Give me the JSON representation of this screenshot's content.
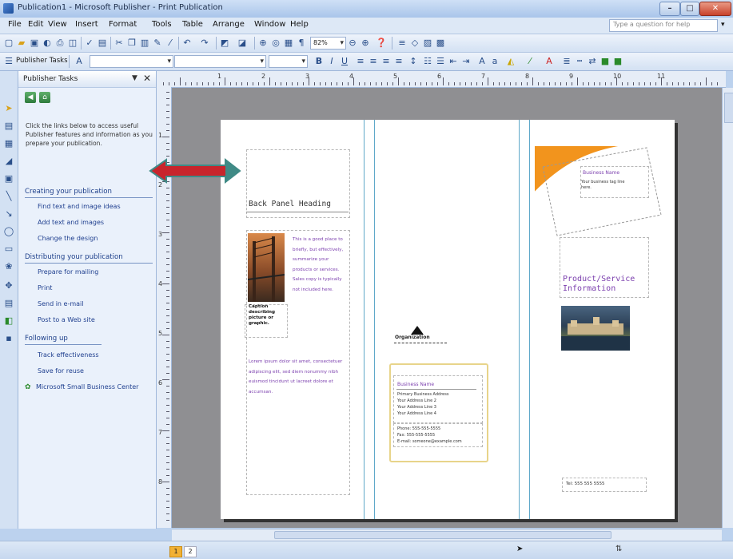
{
  "window": {
    "title": "Publication1 - Microsoft Publisher - Print Publication"
  },
  "menu": {
    "items": [
      "File",
      "Edit",
      "View",
      "Insert",
      "Format",
      "Tools",
      "Table",
      "Arrange",
      "Window",
      "Help"
    ],
    "help_placeholder": "Type a question for help"
  },
  "toolbar": {
    "zoom": "82%",
    "tasks_button": "Publisher Tasks"
  },
  "task_pane": {
    "title": "Publisher Tasks",
    "intro": "Click the links below to access useful Publisher features and information as you prepare your publication.",
    "sections": [
      {
        "title": "Creating your publication",
        "links": [
          "Find text and image ideas",
          "Add text and images",
          "Change the design"
        ]
      },
      {
        "title": "Distributing your publication",
        "links": [
          "Prepare for mailing",
          "Print",
          "Send in e-mail",
          "Post to a Web site"
        ]
      },
      {
        "title": "Following up",
        "links": [
          "Track effectiveness",
          "Save for reuse",
          "Microsoft Small Business Center"
        ]
      }
    ]
  },
  "ruler": {
    "h_labels": [
      "1",
      "2",
      "3",
      "4",
      "5",
      "6",
      "7",
      "8",
      "9",
      "10",
      "11"
    ],
    "v_labels": [
      "1",
      "2",
      "3",
      "4",
      "5",
      "6",
      "7",
      "8"
    ]
  },
  "document": {
    "back_panel_heading": "Back Panel Heading",
    "panel_text": "This is a good place to briefly, but effectively, summarize your products or services. Sales copy is typically not included here.",
    "panel_text_more": "Lorem ipsum dolor sit amet, consectetuer adipiscing elit, sed diem nonummy nibh euismod tincidunt ut lacreet dolore et accumsan.",
    "caption": "Caption describing picture or graphic.",
    "organization": "Organization",
    "business_name": "Business Name",
    "biz_lines": [
      "Primary Business Address",
      "Your Address Line 2",
      "Your Address Line 3",
      "Your Address Line 4"
    ],
    "biz_lines_2": [
      "Phone: 555-555-5555",
      "Fax: 555-555-5555",
      "E-mail: someone@example.com"
    ],
    "card_name": "Business Name",
    "card_tagline": "Your business tag line here.",
    "product_heading": "Product/Service Information",
    "phone_line": "Tel: 555 555 5555"
  },
  "status": {
    "pages": [
      "1",
      "2"
    ]
  },
  "colors": {
    "accent_orange": "#f2941d",
    "arrow_red": "#c8252c",
    "arrow_teal": "#3f8a86",
    "text_purple": "#7b3fae"
  }
}
